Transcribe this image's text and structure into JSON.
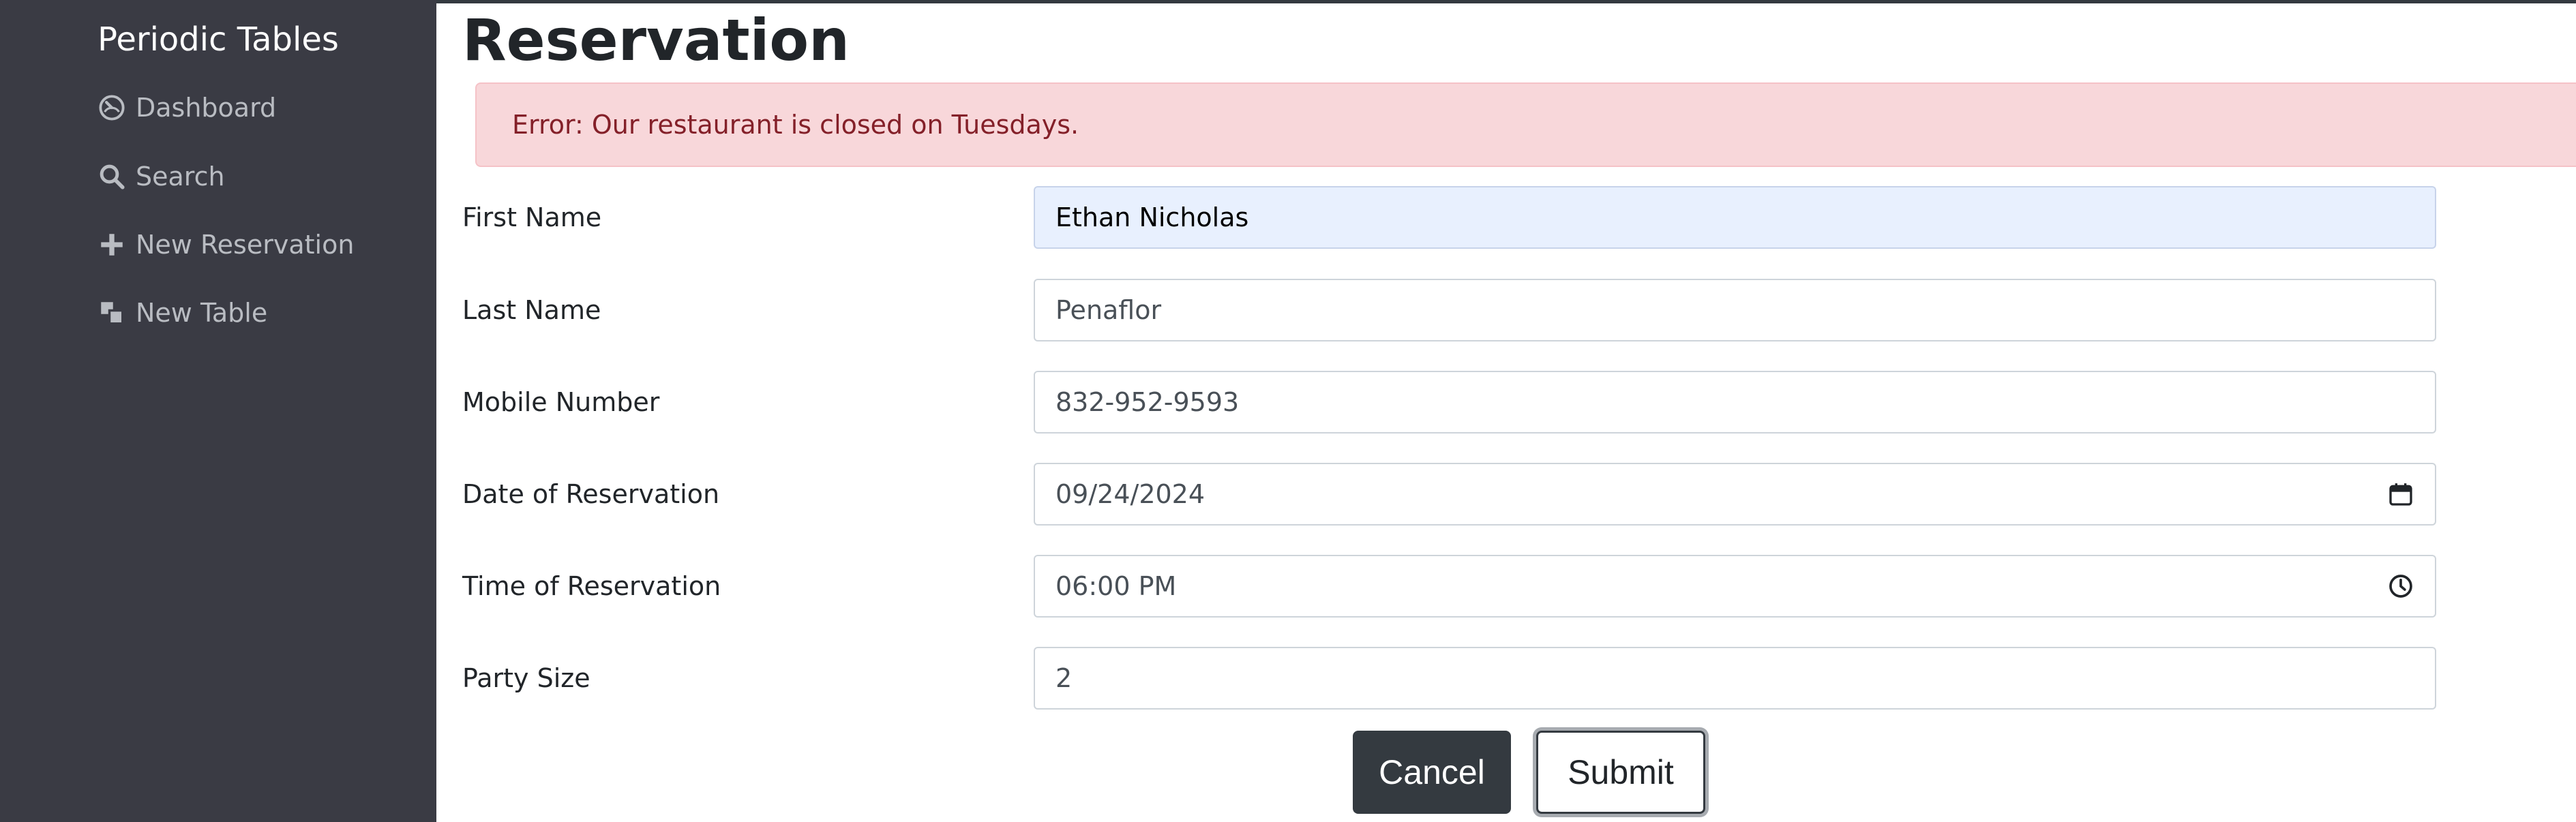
{
  "sidebar": {
    "brand": "Periodic Tables",
    "items": [
      {
        "label": "Dashboard",
        "icon": "dashboard-icon"
      },
      {
        "label": "Search",
        "icon": "search-icon"
      },
      {
        "label": "New Reservation",
        "icon": "plus-icon"
      },
      {
        "label": "New Table",
        "icon": "table-icon"
      }
    ]
  },
  "main": {
    "title": "Reservation",
    "alert": "Error: Our restaurant is closed on Tuesdays.",
    "form": {
      "first_name": {
        "label": "First Name",
        "value": "Ethan Nicholas"
      },
      "last_name": {
        "label": "Last Name",
        "value": "Penaflor"
      },
      "mobile_number": {
        "label": "Mobile Number",
        "value": "832-952-9593"
      },
      "reservation_date": {
        "label": "Date of Reservation",
        "value": "09/24/2024",
        "icon": "calendar-icon"
      },
      "reservation_time": {
        "label": "Time of Reservation",
        "value": "06:00 PM",
        "icon": "clock-icon"
      },
      "party_size": {
        "label": "Party Size",
        "value": "2"
      }
    },
    "buttons": {
      "cancel": "Cancel",
      "submit": "Submit"
    }
  },
  "colors": {
    "sidebar_bg": "#3a3b44",
    "alert_bg": "#f8d7da",
    "alert_text": "#842029",
    "autofill_bg": "#e8f0fe",
    "dark_button": "#343a40"
  }
}
